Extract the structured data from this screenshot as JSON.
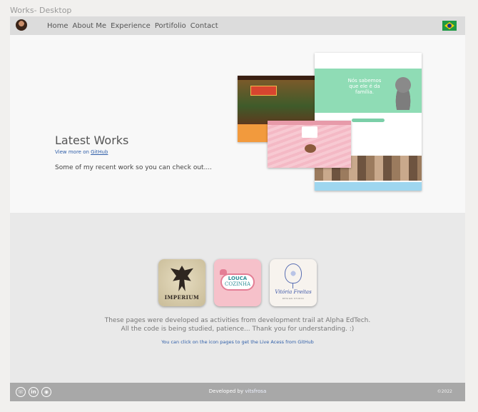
{
  "frame_title": "Works- Desktop",
  "nav": {
    "links": [
      "Home",
      "About Me",
      "Experience",
      "Portifolio",
      "Contact"
    ]
  },
  "hero": {
    "title": "Latest Works",
    "link_prefix": "View more on ",
    "link_text": "GitHub",
    "description": "Some of my recent work so you can check out...."
  },
  "mockups": {
    "cat_site_headline": "Nós sabemos que ele é da família."
  },
  "projects": {
    "tiles": [
      {
        "name": "imperium",
        "logo_text": "IMPERIUM"
      },
      {
        "name": "louca-cozinha",
        "logo_line1": "LOUCA",
        "logo_line2": "COZINHA"
      },
      {
        "name": "vitoria-freitas",
        "logo_text": "Vitória Freitas",
        "logo_sub": "DESIGN STUDIO"
      }
    ],
    "line1": "These pages were developed as activities from development trail at Alpha EdTech.",
    "line2": "All the code is being studied, patience... Thank you for understanding. :)",
    "hint": "You can click on the icon pages to get the Live Acess from GitHub"
  },
  "footer": {
    "developed_by": "Developed by ",
    "username": "vitsfrosa",
    "copyright": "©2022",
    "social_icons": [
      "whatsapp-icon",
      "linkedin-icon",
      "github-icon"
    ]
  },
  "colors": {
    "nav_bg": "#dcdcdc",
    "hero_bg": "#f8f8f8",
    "footer_bg": "#a8a8a8",
    "link": "#2f5ea8"
  }
}
